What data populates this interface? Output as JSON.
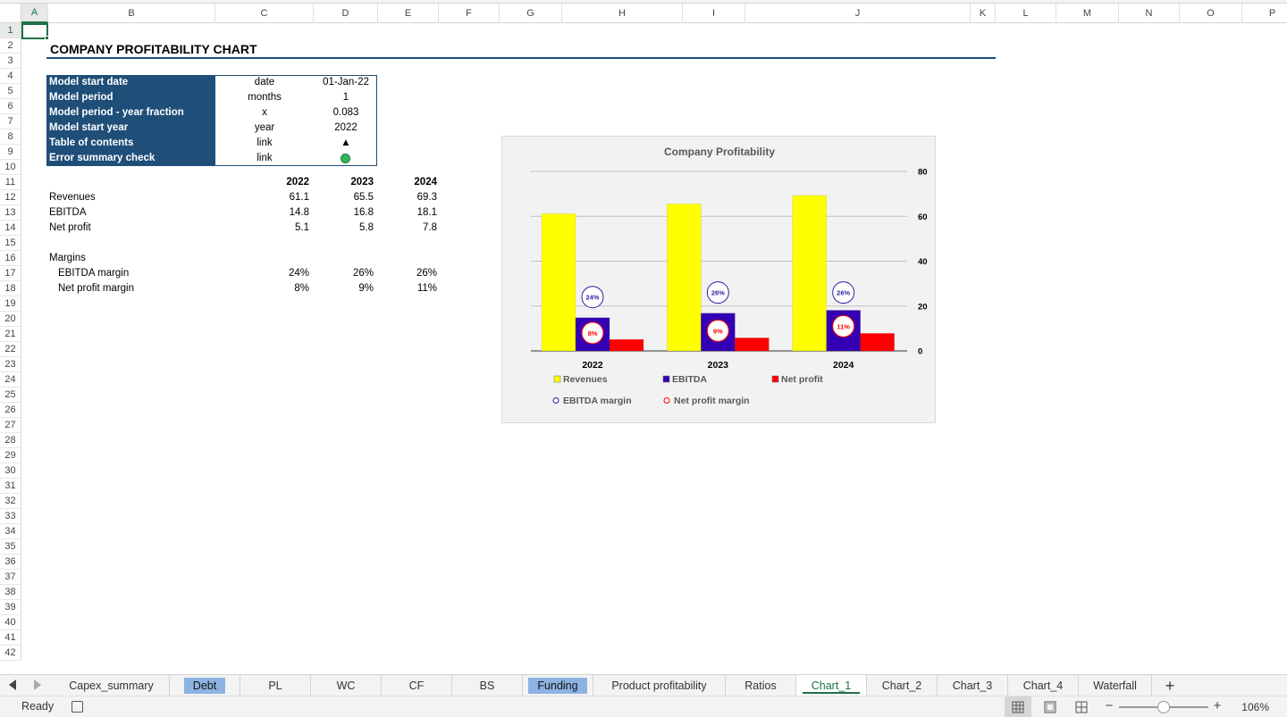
{
  "columns": [
    "A",
    "B",
    "C",
    "D",
    "E",
    "F",
    "G",
    "H",
    "I",
    "J",
    "K",
    "L",
    "M",
    "N",
    "O",
    "P"
  ],
  "rows": [
    "1",
    "2",
    "3",
    "4",
    "5",
    "6",
    "7",
    "8",
    "9",
    "10",
    "11",
    "12",
    "13",
    "14",
    "15",
    "16",
    "17",
    "18",
    "19",
    "20",
    "21",
    "22",
    "23",
    "24",
    "25",
    "26",
    "27",
    "28",
    "29",
    "30",
    "31",
    "32",
    "33",
    "34",
    "35",
    "36",
    "37",
    "38",
    "39",
    "40",
    "41",
    "42"
  ],
  "active_cell": {
    "column": "A",
    "row": "1"
  },
  "title": "COMPANY PROFITABILITY CHART",
  "params": [
    {
      "label": "Model start date",
      "unit": "date",
      "value": "01-Jan-22"
    },
    {
      "label": "Model period",
      "unit": "months",
      "value": "1"
    },
    {
      "label": "Model period - year fraction",
      "unit": "x",
      "value": "0.083"
    },
    {
      "label": "Model start year",
      "unit": "year",
      "value": "2022"
    },
    {
      "label": "Table of contents",
      "unit": "link",
      "value": "▲"
    },
    {
      "label": "Error summary check",
      "unit": "link",
      "value": ""
    }
  ],
  "table": {
    "years": [
      "2022",
      "2023",
      "2024"
    ],
    "rows": [
      {
        "label": "Revenues",
        "values": [
          "61.1",
          "65.5",
          "69.3"
        ]
      },
      {
        "label": "EBITDA",
        "values": [
          "14.8",
          "16.8",
          "18.1"
        ]
      },
      {
        "label": "Net profit",
        "values": [
          "5.1",
          "5.8",
          "7.8"
        ]
      }
    ],
    "margins_header": "Margins",
    "margins": [
      {
        "label": "EBITDA margin",
        "values": [
          "24%",
          "26%",
          "26%"
        ]
      },
      {
        "label": "Net profit margin",
        "values": [
          "8%",
          "9%",
          "11%"
        ]
      }
    ]
  },
  "chart_data": {
    "type": "bar",
    "title": "Company Profitability",
    "categories": [
      "2022",
      "2023",
      "2024"
    ],
    "series": [
      {
        "name": "Revenues",
        "values": [
          61.1,
          65.5,
          69.3
        ],
        "color": "#ffff00"
      },
      {
        "name": "EBITDA",
        "values": [
          14.8,
          16.8,
          18.1
        ],
        "color": "#3300b3"
      },
      {
        "name": "Net profit",
        "values": [
          5.1,
          5.8,
          7.8
        ],
        "color": "#ff0000"
      }
    ],
    "markers": [
      {
        "name": "EBITDA margin",
        "labels": [
          "24%",
          "26%",
          "26%"
        ],
        "values": [
          24,
          26,
          26
        ],
        "color": "#2b1fa8"
      },
      {
        "name": "Net profit margin",
        "labels": [
          "8%",
          "9%",
          "11%"
        ],
        "values": [
          8,
          9,
          11
        ],
        "color": "#ff0000"
      }
    ],
    "ylim": [
      0,
      80
    ],
    "yticks": [
      "0",
      "20",
      "40",
      "60",
      "80"
    ],
    "grid": true,
    "legend_position": "bottom"
  },
  "sheet_tabs": [
    {
      "label": "Capex_summary",
      "state": "normal"
    },
    {
      "label": "Debt",
      "state": "highlight"
    },
    {
      "label": "PL",
      "state": "normal"
    },
    {
      "label": "WC",
      "state": "normal"
    },
    {
      "label": "CF",
      "state": "normal"
    },
    {
      "label": "BS",
      "state": "normal"
    },
    {
      "label": "Funding",
      "state": "highlight"
    },
    {
      "label": "Product profitability",
      "state": "normal"
    },
    {
      "label": "Ratios",
      "state": "normal"
    },
    {
      "label": "Chart_1",
      "state": "active"
    },
    {
      "label": "Chart_2",
      "state": "normal"
    },
    {
      "label": "Chart_3",
      "state": "normal"
    },
    {
      "label": "Chart_4",
      "state": "normal"
    },
    {
      "label": "Waterfall",
      "state": "normal"
    }
  ],
  "add_sheet_label": "+",
  "status": {
    "text": "Ready",
    "zoom": "106%",
    "zoom_minus": "−",
    "zoom_plus": "+"
  },
  "colors": {
    "header_blue": "#1f4e79",
    "excel_green": "#1e7145",
    "tab_highlight": "#8db3e2"
  }
}
